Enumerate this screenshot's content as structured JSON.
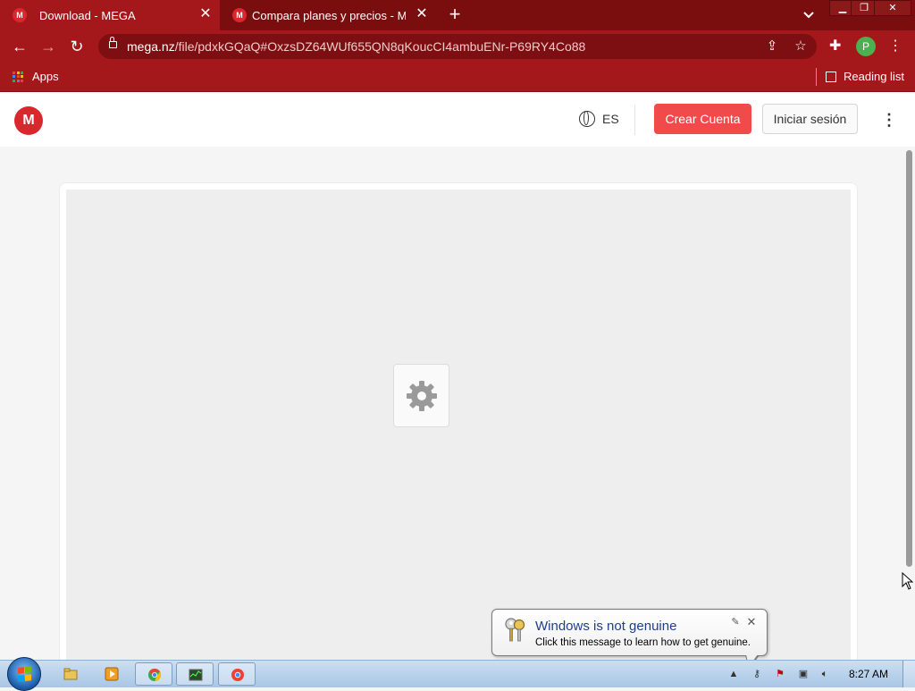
{
  "browser": {
    "tabs": [
      {
        "title": "Download - MEGA",
        "favicon": "M",
        "active": true
      },
      {
        "title": "Compara planes y precios - MEGA",
        "favicon": "M",
        "active": false
      }
    ],
    "url_host": "mega.nz",
    "url_path": "/file/pdxkGQaQ#OxzsDZ64WUf655QN8qKoucCI4ambuENr-P69RY4Co88",
    "profile_initial": "P",
    "bookmarks": {
      "apps_label": "Apps",
      "reading_list_label": "Reading list"
    },
    "theme_color": "#a4171a"
  },
  "page": {
    "logo_letter": "M",
    "language": "ES",
    "create_account_label": "Crear Cuenta",
    "login_label": "Iniciar sesión",
    "brand_color": "#d9272e",
    "accent_button_color": "#f04a4a"
  },
  "notification": {
    "title": "Windows is not genuine",
    "message": "Click this message to learn how to get genuine."
  },
  "taskbar": {
    "clock": "8:27 AM",
    "pinned": [
      "explorer-icon",
      "media-player-icon",
      "chrome-icon",
      "task-manager-icon",
      "chrome-icon"
    ]
  }
}
